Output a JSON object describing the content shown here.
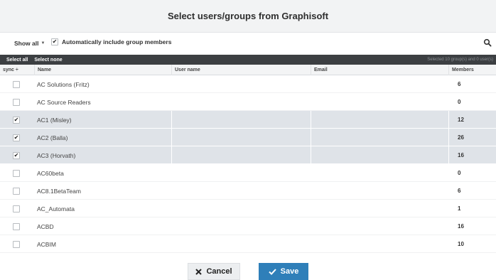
{
  "dialog": {
    "title": "Select users/groups from Graphisoft"
  },
  "filter": {
    "show_all_label": "Show all",
    "auto_include_label": "Automatically include group members",
    "auto_include_checked": true
  },
  "toolbar": {
    "select_all": "Select all",
    "select_none": "Select none",
    "status": "Selected 10 group(s) and 0 user(s)"
  },
  "table": {
    "columns": [
      "sync ÷",
      "Name",
      "User name",
      "Email",
      "Members"
    ],
    "rows": [
      {
        "checked": false,
        "name": "AC Solutions (Fritz)",
        "members": "6"
      },
      {
        "checked": false,
        "name": "AC Source Readers",
        "members": "0"
      },
      {
        "checked": true,
        "name": "AC1 (Misley)",
        "members": "12"
      },
      {
        "checked": true,
        "name": "AC2 (Balla)",
        "members": "26"
      },
      {
        "checked": true,
        "name": "AC3 (Horvath)",
        "members": "16"
      },
      {
        "checked": false,
        "name": "AC60beta",
        "members": "0"
      },
      {
        "checked": false,
        "name": "AC8.1BetaTeam",
        "members": "6"
      },
      {
        "checked": false,
        "name": "AC_Automata",
        "members": "1"
      },
      {
        "checked": false,
        "name": "ACBD",
        "members": "16"
      },
      {
        "checked": false,
        "name": "ACBIM",
        "members": "10"
      }
    ]
  },
  "buttons": {
    "cancel_label": "Cancel",
    "save_label": "Save"
  },
  "icons": {
    "check": "check-icon",
    "close": "close-icon",
    "search": "search-icon",
    "caret": "caret-down-icon"
  },
  "colors": {
    "primary": "#2f7fb9",
    "toolbar_bg": "#3c3f42",
    "selected_row": "#dfe3e8"
  }
}
